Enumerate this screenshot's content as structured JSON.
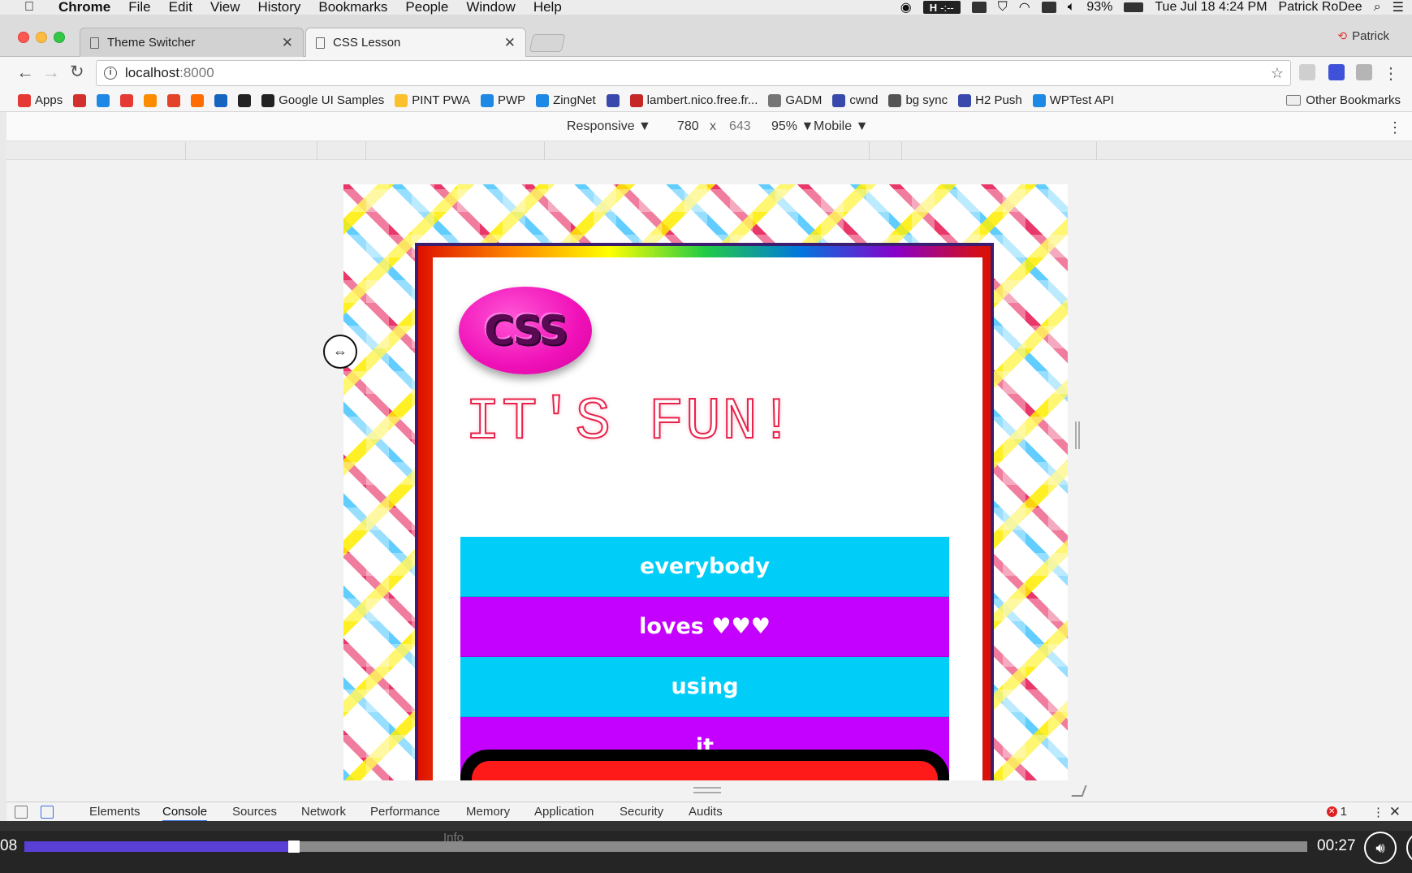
{
  "menubar": {
    "app": "Chrome",
    "menus": [
      "File",
      "Edit",
      "View",
      "History",
      "Bookmarks",
      "People",
      "Window",
      "Help"
    ],
    "status": {
      "tray_label": "-:--",
      "battery": "93%",
      "datetime": "Tue Jul 18  4:24 PM",
      "user": "Patrick RoDee"
    }
  },
  "tabs": [
    {
      "title": "Theme Switcher",
      "active": false
    },
    {
      "title": "CSS Lesson",
      "active": true
    }
  ],
  "profile_name": "Patrick",
  "omnibox": {
    "host": "localhost",
    "port": ":8000"
  },
  "bookmarks": [
    {
      "label": "Apps",
      "color": "#e53935"
    },
    {
      "label": "",
      "color": "#d32f2f",
      "icon": "gmail-icon"
    },
    {
      "label": "",
      "color": "#1e88e5",
      "icon": "pint-icon"
    },
    {
      "label": "",
      "color": "#e53935",
      "icon": "js-icon"
    },
    {
      "label": "",
      "color": "#fb8c00",
      "icon": "h-icon"
    },
    {
      "label": "",
      "color": "#e24329",
      "icon": "gitlab-icon"
    },
    {
      "label": "",
      "color": "#ff6d00",
      "icon": "m-icon"
    },
    {
      "label": "",
      "color": "#1565c0",
      "icon": "code-icon"
    },
    {
      "label": "",
      "color": "#222222",
      "icon": "image-icon"
    },
    {
      "label": "Google UI Samples",
      "color": "#222222"
    },
    {
      "label": "PINT PWA",
      "color": "#fbc02d"
    },
    {
      "label": "PWP",
      "color": "#1e88e5"
    },
    {
      "label": "ZingNet",
      "color": "#1e88e5"
    },
    {
      "label": "",
      "color": "#3949ab",
      "icon": "list-icon"
    },
    {
      "label": "lambert.nico.free.fr...",
      "color": "#c62828"
    },
    {
      "label": "GADM",
      "color": "#757575"
    },
    {
      "label": "cwnd",
      "color": "#3949ab"
    },
    {
      "label": "bg sync",
      "color": "#555555"
    },
    {
      "label": "H2 Push",
      "color": "#3949ab"
    },
    {
      "label": "WPTest API",
      "color": "#1e88e5"
    }
  ],
  "other_bookmarks": "Other Bookmarks",
  "device_toolbar": {
    "device": "Responsive ▼",
    "width": "780",
    "times": "x",
    "height": "643",
    "zoom": "95% ▼",
    "mode": "Mobile ▼"
  },
  "page": {
    "badge": "CSS",
    "headline": "IT'S FUN!",
    "words": [
      {
        "text": "everybody",
        "color": "cyan"
      },
      {
        "text": "loves ♥♥♥",
        "color": "magenta"
      },
      {
        "text": "using",
        "color": "cyan"
      },
      {
        "text": "it",
        "color": "magenta"
      }
    ]
  },
  "devtools": {
    "tabs": [
      "Elements",
      "Console",
      "Sources",
      "Network",
      "Performance",
      "Memory",
      "Application",
      "Security",
      "Audits"
    ],
    "active_tab": "Console",
    "error_count": "1",
    "filter_level": "Info"
  },
  "video": {
    "elapsed": "08",
    "remaining": "00:27",
    "progress": 0.21
  },
  "colors": {
    "accent_cyan": "#00cef9",
    "accent_magenta": "#c400ff",
    "badge_pink": "#f010b8",
    "headline_red": "#e8224a"
  }
}
